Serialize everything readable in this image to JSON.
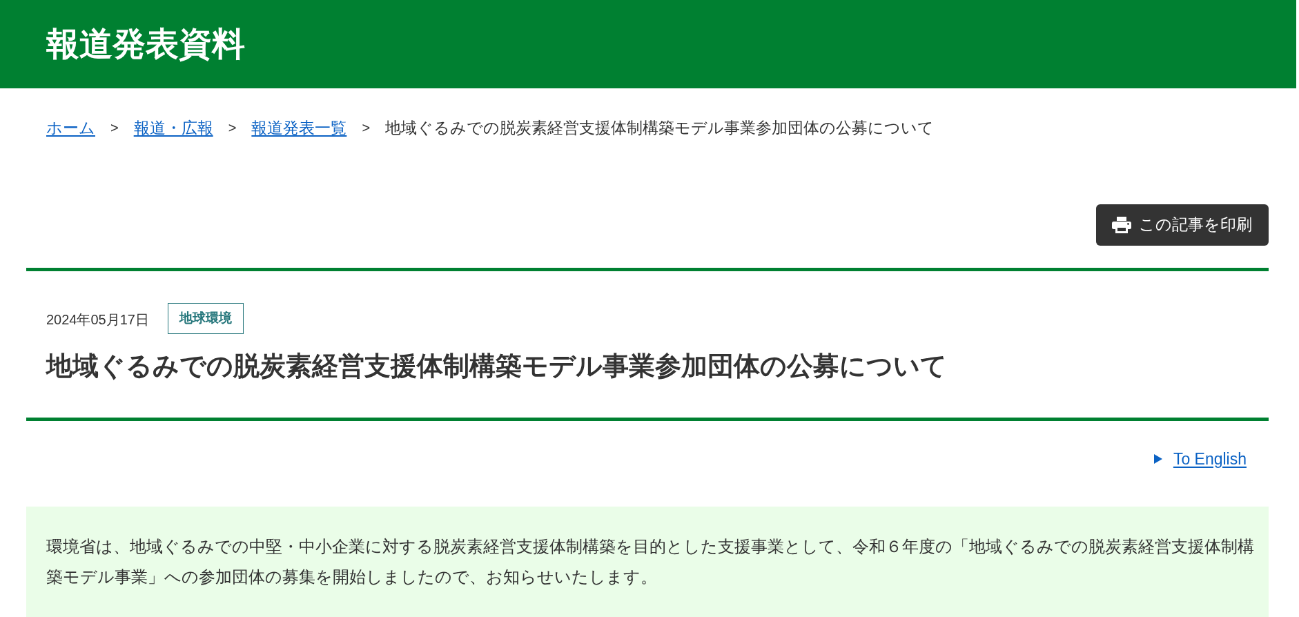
{
  "header": {
    "title": "報道発表資料"
  },
  "breadcrumb": [
    {
      "kind": "link",
      "label": "ホーム"
    },
    {
      "kind": "separator",
      "label": ">"
    },
    {
      "kind": "link",
      "label": "報道・広報"
    },
    {
      "kind": "separator",
      "label": ">"
    },
    {
      "kind": "link",
      "label": "報道発表一覧"
    },
    {
      "kind": "separator",
      "label": ">"
    },
    {
      "kind": "current",
      "label": "地域ぐるみでの脱炭素経営支援体制構築モデル事業参加団体の公募について"
    }
  ],
  "print_button": {
    "label": "この記事を印刷"
  },
  "article": {
    "date": "2024年05月17日",
    "category": "地球環境",
    "title": "地域ぐるみでの脱炭素経営支援体制構築モデル事業参加団体の公募について",
    "language_link": {
      "label": "To English"
    },
    "summary": "環境省は、地域ぐるみでの中堅・中小企業に対する脱炭素経営支援体制構築を目的とした支援事業として、令和６年度の「地域ぐるみでの脱炭素経営支援体制構築モデル事業」への参加団体の募集を開始しましたので、お知らせいたします。"
  }
}
